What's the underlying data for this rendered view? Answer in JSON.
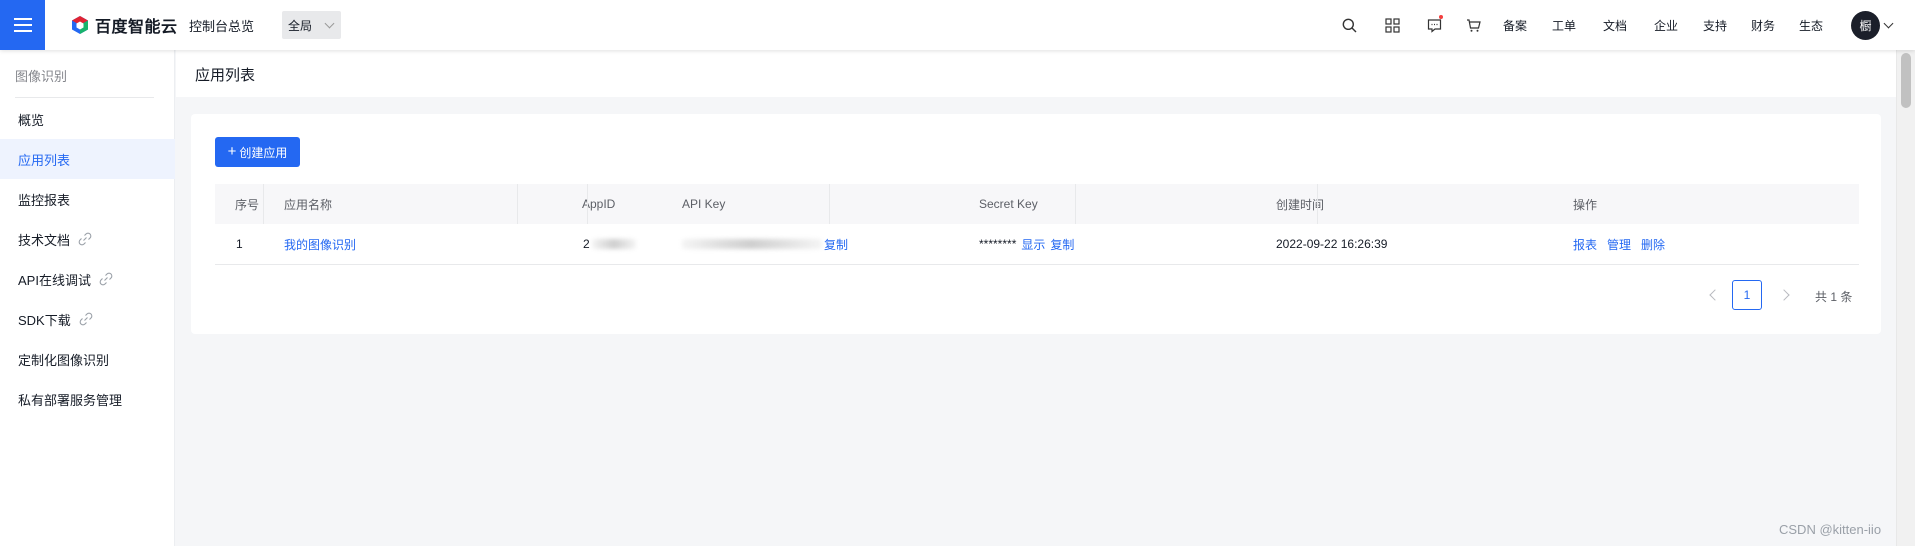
{
  "topbar": {
    "logo_text": "百度智能云",
    "console_label": "控制台总览",
    "region": "全局",
    "links": [
      "备案",
      "工单",
      "文档",
      "企业",
      "支持",
      "财务",
      "生态"
    ],
    "avatar_text": "橱",
    "icons": [
      "search-icon",
      "apps-icon",
      "message-icon",
      "cart-icon"
    ],
    "brand_color": "#2468f2"
  },
  "sidebar": {
    "title": "图像识别",
    "items": [
      {
        "label": "概览",
        "active": false,
        "external": false
      },
      {
        "label": "应用列表",
        "active": true,
        "external": false
      },
      {
        "label": "监控报表",
        "active": false,
        "external": false
      },
      {
        "label": "技术文档",
        "active": false,
        "external": true
      },
      {
        "label": "API在线调试",
        "active": false,
        "external": true
      },
      {
        "label": "SDK下载",
        "active": false,
        "external": true
      },
      {
        "label": "定制化图像识别",
        "active": false,
        "external": false
      },
      {
        "label": "私有部署服务管理",
        "active": false,
        "external": false
      }
    ]
  },
  "page": {
    "title": "应用列表"
  },
  "toolbar": {
    "create_label": "创建应用"
  },
  "table": {
    "headers": [
      "序号",
      "应用名称",
      "AppID",
      "API Key",
      "Secret Key",
      "创建时间",
      "操作"
    ],
    "rows": [
      {
        "index": "1",
        "name": "我的图像识别",
        "app_id_visible": "2",
        "api_key_visible": "ZP  1U  78  XYOE    U0L",
        "api_key_copy": "复制",
        "secret_key": "********",
        "secret_show": "显示",
        "secret_copy": "复制",
        "created_at": "2022-09-22 16:26:39",
        "actions": [
          "报表",
          "管理",
          "删除"
        ]
      }
    ]
  },
  "pagination": {
    "current_page": "1",
    "total_text": "共 1 条"
  },
  "watermark": "CSDN @kitten-iio"
}
